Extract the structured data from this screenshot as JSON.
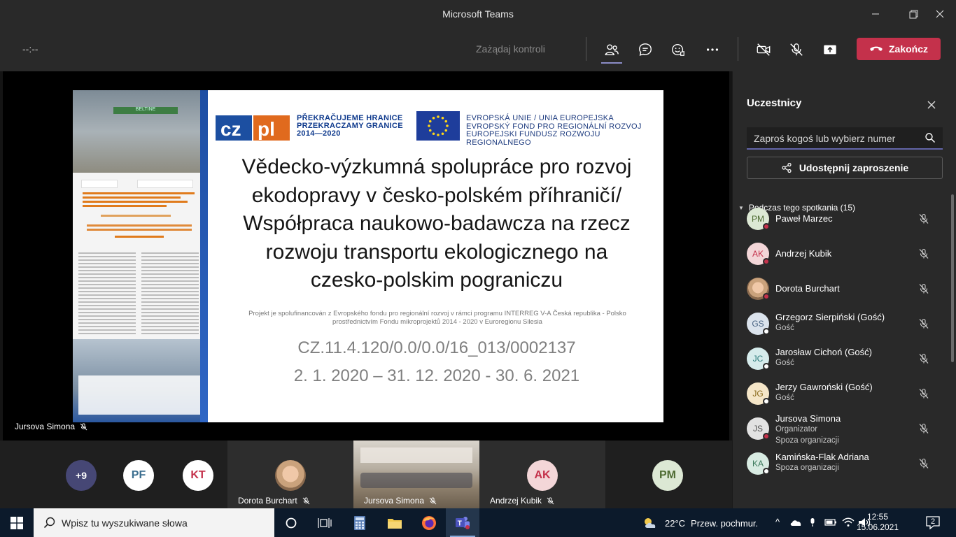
{
  "window": {
    "title": "Microsoft Teams",
    "minimize": "—",
    "maximize": "❐",
    "close": "✕"
  },
  "toolbar": {
    "timer": "--:--",
    "request_control": "Zażądaj kontroli",
    "end_call": "Zakończ"
  },
  "slide": {
    "czpl_line1": "PŘEKRAČUJEME HRANICE",
    "czpl_line2": "PRZEKRACZAMY GRANICE",
    "czpl_line3": "2014—2020",
    "eu_line1": "EVROPSKÁ UNIE / UNIA EUROPEJSKA",
    "eu_line2": "EVROPSKÝ FOND PRO REGIONÁLNÍ ROZVOJ",
    "eu_line3": "EUROPEJSKI FUNDUSZ ROZWOJU REGIONALNEGO",
    "title_line1": "Vědecko-výzkumná spolupráce pro rozvoj",
    "title_line2": "ekodopravy v česko-polském příhraničí/",
    "title_line3": "Współpraca naukowo-badawcza na rzecz",
    "title_line4": "rozwoju transportu ekologicznego na",
    "title_line5": "czesko-polskim pograniczu",
    "note_line1": "Projekt je spolufinancován z Evropského fondu pro regionální rozvoj v rámci programu INTERREG V-A Česká republika - Polsko",
    "note_line2": "prostřednictvím Fondu mikroprojektů 2014 - 2020 v Euroregionu Silesia",
    "code": "CZ.11.4.120/0.0/0.0/16_013/0002137",
    "dates": "2. 1. 2020 – 31. 12. 2020 -  30. 6. 2021",
    "poster_banner": "BELTINE"
  },
  "presenter": {
    "name": "Jursova Simona"
  },
  "strip": {
    "more_count": "+9",
    "tiles": [
      {
        "initials": "PF",
        "color": "#ffffff",
        "text_color": "#3b6e8f"
      },
      {
        "initials": "KT",
        "color": "#ffffff",
        "text_color": "#c4314b"
      },
      {
        "name": "Dorota Burchart"
      },
      {
        "name": "Jursova Simona"
      },
      {
        "initials": "AK",
        "name": "Andrzej Kubik",
        "text_color": "#c4314b"
      },
      {
        "initials": "PM",
        "text_color": "#4e6b32"
      }
    ]
  },
  "panel": {
    "title": "Uczestnicy",
    "search_placeholder": "Zaproś kogoś lub wybierz numer",
    "share_button": "Udostępnij zaproszenie",
    "section": "Podczas tego spotkania (15)",
    "participants": [
      {
        "initials": "PM",
        "name": "Paweł Marzec",
        "sub": "",
        "sub2": "",
        "avatar_bg": "#dce8d4",
        "avatar_fg": "#4e6b32",
        "status": "#c4314b"
      },
      {
        "initials": "AK",
        "name": "Andrzej Kubik",
        "sub": "",
        "sub2": "",
        "avatar_bg": "#f3d6d8",
        "avatar_fg": "#c4314b",
        "status": "#c4314b"
      },
      {
        "initials": "",
        "name": "Dorota Burchart",
        "sub": "",
        "sub2": "",
        "avatar_bg": "#caa27c",
        "avatar_fg": "#fff",
        "status": "#c4314b"
      },
      {
        "initials": "GS",
        "name": "Grzegorz Sierpiński (Gość)",
        "sub": "Gość",
        "sub2": "",
        "avatar_bg": "#dbe3ec",
        "avatar_fg": "#4b6584",
        "status": "#ffffff"
      },
      {
        "initials": "JC",
        "name": "Jarosław Cichoń (Gość)",
        "sub": "Gość",
        "sub2": "",
        "avatar_bg": "#d6ecec",
        "avatar_fg": "#2e7d7d",
        "status": "#ffffff"
      },
      {
        "initials": "JG",
        "name": "Jerzy Gawroński (Gość)",
        "sub": "Gość",
        "sub2": "",
        "avatar_bg": "#f5e6c8",
        "avatar_fg": "#8a6a1c",
        "status": "#ffffff"
      },
      {
        "initials": "JS",
        "name": "Jursova Simona",
        "sub": "Organizator",
        "sub2": "Spoza organizacji",
        "avatar_bg": "#e2e2e2",
        "avatar_fg": "#555",
        "status": "#c4314b"
      },
      {
        "initials": "KA",
        "name": "Kamińska-Flak Adriana",
        "sub": "Spoza organizacji",
        "sub2": "",
        "avatar_bg": "#d8ebe2",
        "avatar_fg": "#3c7a5c",
        "status": "#ffffff"
      }
    ]
  },
  "taskbar": {
    "search_placeholder": "Wpisz tu wyszukiwane słowa",
    "weather_temp": "22°C",
    "weather_desc": "Przew. pochmur.",
    "time": "12:55",
    "date": "15.06.2021",
    "notifications": "2"
  }
}
